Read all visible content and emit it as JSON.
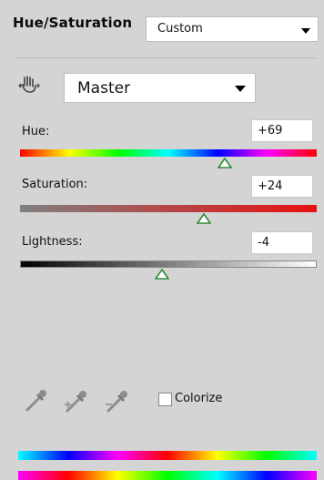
{
  "panel": {
    "title": "Hue/Saturation",
    "preset": {
      "value": "Custom"
    },
    "channel": {
      "value": "Master"
    }
  },
  "adjustments": {
    "hue": {
      "label": "Hue:",
      "display": "+69",
      "value": 69,
      "min": -180,
      "max": 180
    },
    "saturation": {
      "label": "Saturation:",
      "display": "+24",
      "value": 24,
      "min": -100,
      "max": 100
    },
    "lightness": {
      "label": "Lightness:",
      "display": "-4",
      "value": -4,
      "min": -100,
      "max": 100
    }
  },
  "tools": {
    "icons": [
      "target-adjust-icon",
      "eyedropper-icon",
      "eyedropper-plus-icon",
      "eyedropper-minus-icon"
    ],
    "colorize": {
      "label": "Colorize",
      "checked": false
    }
  },
  "colors": {
    "panel_bg": "#d4d4d4",
    "thumb_fill": "#ffffff",
    "thumb_stroke": "#2e8b3a"
  }
}
